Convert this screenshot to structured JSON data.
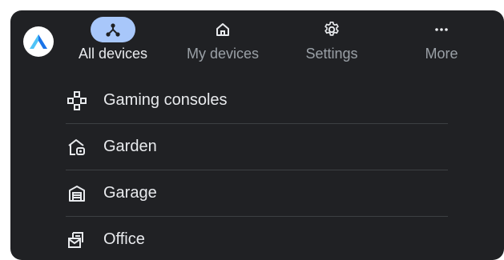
{
  "nav": {
    "items": [
      {
        "label": "All devices",
        "icon": "device-hub-icon",
        "active": true
      },
      {
        "label": "My devices",
        "icon": "home-icon",
        "active": false
      },
      {
        "label": "Settings",
        "icon": "gear-icon",
        "active": false
      },
      {
        "label": "More",
        "icon": "more-horiz-icon",
        "active": false
      }
    ]
  },
  "devices": {
    "items": [
      {
        "label": "Gaming consoles",
        "icon": "gamepad-icon"
      },
      {
        "label": "Garden",
        "icon": "garden-house-icon"
      },
      {
        "label": "Garage",
        "icon": "garage-icon"
      },
      {
        "label": "Office",
        "icon": "office-mailbox-icon"
      }
    ]
  },
  "colors": {
    "background": "#202124",
    "active_pill": "#a8c7fa",
    "text_primary": "#e8eaed",
    "text_secondary": "#9aa0a6",
    "logo_accent": "#1a73e8"
  }
}
